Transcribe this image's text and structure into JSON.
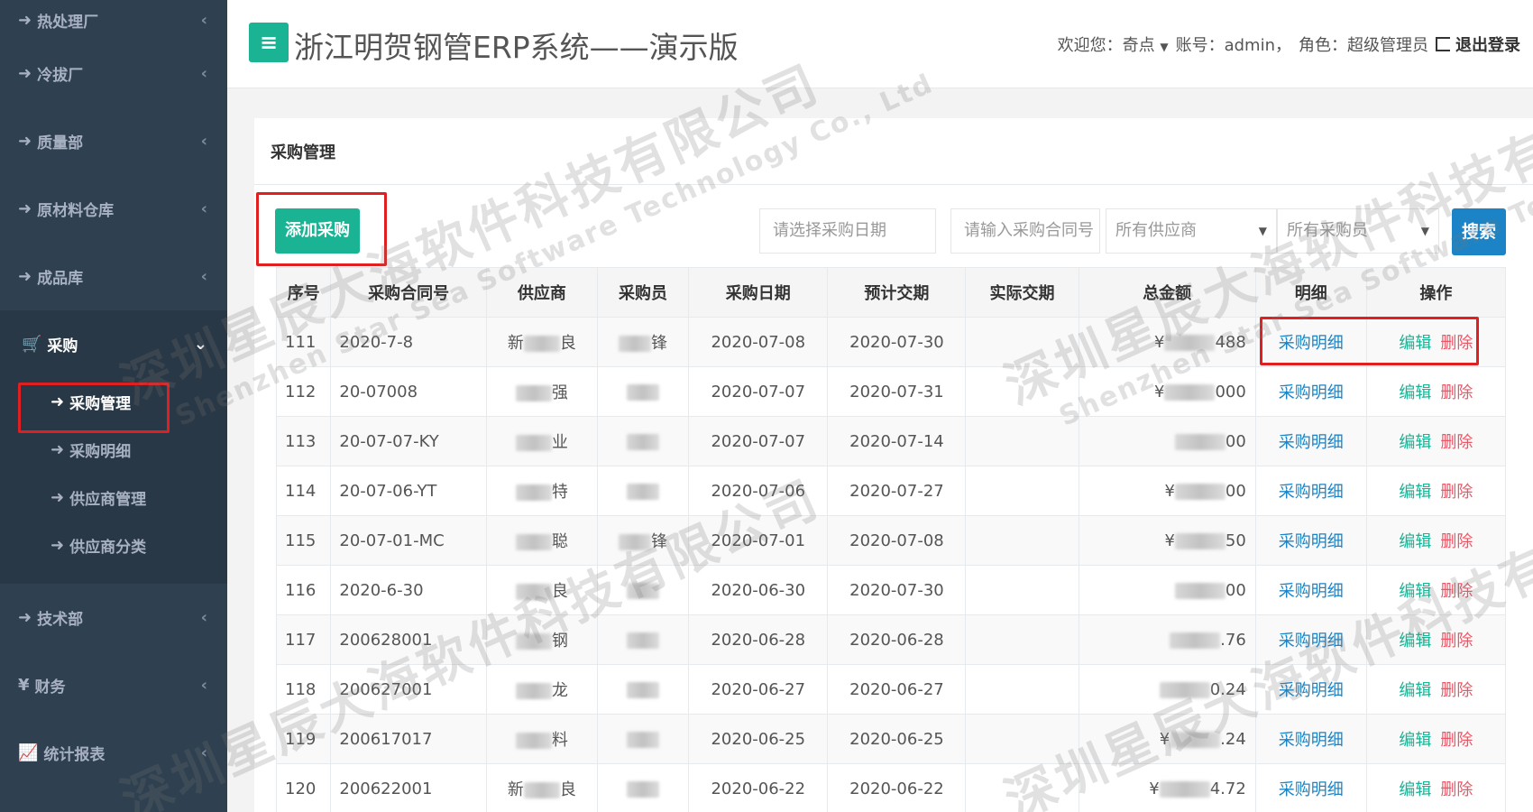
{
  "sidebar": {
    "items_top": [
      {
        "label": "热处理厂"
      },
      {
        "label": "冷拔厂"
      },
      {
        "label": "质量部"
      },
      {
        "label": "原材料仓库"
      },
      {
        "label": "成品库"
      }
    ],
    "active_group": {
      "label": "采购",
      "children": [
        {
          "label": "采购管理",
          "active": true
        },
        {
          "label": "采购明细"
        },
        {
          "label": "供应商管理"
        },
        {
          "label": "供应商分类"
        }
      ]
    },
    "items_bottom": [
      {
        "label": "技术部",
        "prefix": "➜"
      },
      {
        "label": "财务",
        "prefix": "¥"
      },
      {
        "label": "统计报表",
        "prefix": "📈"
      }
    ]
  },
  "header": {
    "title": "浙江明贺钢管ERP系统——演示版",
    "welcome": "欢迎您：奇点",
    "account": "账号：admin，",
    "role": "角色：超级管理员",
    "logout": "退出登录"
  },
  "panel": {
    "title": "采购管理",
    "add_button": "添加采购",
    "search": {
      "date_placeholder": "请选择采购日期",
      "contract_placeholder": "请输入采购合同号",
      "supplier_select": "所有供应商",
      "buyer_select": "所有采购员",
      "button": "搜索"
    },
    "table": {
      "headers": [
        "序号",
        "采购合同号",
        "供应商",
        "采购员",
        "采购日期",
        "预计交期",
        "实际交期",
        "总金额",
        "明细",
        "操作"
      ],
      "rows": [
        {
          "id": "111",
          "contract": "2020-7-8",
          "supplier_a": "新",
          "supplier_b": "良",
          "buyer": "锋",
          "date": "2020-07-08",
          "eta": "2020-07-30",
          "actual": "",
          "amount_a": "¥",
          "amount_b": "488"
        },
        {
          "id": "112",
          "contract": "20-07008",
          "supplier_a": "",
          "supplier_b": "强",
          "buyer": "",
          "date": "2020-07-07",
          "eta": "2020-07-31",
          "actual": "",
          "amount_a": "¥",
          "amount_b": "000"
        },
        {
          "id": "113",
          "contract": "20-07-07-KY",
          "supplier_a": "",
          "supplier_b": "业",
          "buyer": "",
          "date": "2020-07-07",
          "eta": "2020-07-14",
          "actual": "",
          "amount_a": "",
          "amount_b": "00"
        },
        {
          "id": "114",
          "contract": "20-07-06-YT",
          "supplier_a": "",
          "supplier_b": "特",
          "buyer": "",
          "date": "2020-07-06",
          "eta": "2020-07-27",
          "actual": "",
          "amount_a": "¥",
          "amount_b": "00"
        },
        {
          "id": "115",
          "contract": "20-07-01-MC",
          "supplier_a": "",
          "supplier_b": "聪",
          "buyer": "锋",
          "date": "2020-07-01",
          "eta": "2020-07-08",
          "actual": "",
          "amount_a": "¥",
          "amount_b": "50"
        },
        {
          "id": "116",
          "contract": "2020-6-30",
          "supplier_a": "",
          "supplier_b": "良",
          "buyer": "",
          "date": "2020-06-30",
          "eta": "2020-07-30",
          "actual": "",
          "amount_a": "",
          "amount_b": "00"
        },
        {
          "id": "117",
          "contract": "200628001",
          "supplier_a": "",
          "supplier_b": "钢",
          "buyer": "",
          "date": "2020-06-28",
          "eta": "2020-06-28",
          "actual": "",
          "amount_a": "",
          "amount_b": ".76"
        },
        {
          "id": "118",
          "contract": "200627001",
          "supplier_a": "",
          "supplier_b": "龙",
          "buyer": "",
          "date": "2020-06-27",
          "eta": "2020-06-27",
          "actual": "",
          "amount_a": "",
          "amount_b": "0.24"
        },
        {
          "id": "119",
          "contract": "200617017",
          "supplier_a": "",
          "supplier_b": "料",
          "buyer": "",
          "date": "2020-06-25",
          "eta": "2020-06-25",
          "actual": "",
          "amount_a": "¥",
          "amount_b": ".24"
        },
        {
          "id": "120",
          "contract": "200622001",
          "supplier_a": "新",
          "supplier_b": "良",
          "buyer": "",
          "date": "2020-06-22",
          "eta": "2020-06-22",
          "actual": "",
          "amount_a": "¥",
          "amount_b": "4.72"
        }
      ],
      "detail_link": "采购明细",
      "edit_link": "编辑",
      "delete_link": "删除"
    }
  },
  "watermark": {
    "cn": "深圳星辰大海软件科技有限公司",
    "en": "Shenzhen Star Sea Software Technology Co., Ltd"
  },
  "colors": {
    "sidebar": "#2f4050",
    "primary": "#1ab394",
    "blue": "#1c84c6",
    "danger": "#ed5565",
    "highlight": "#e02020"
  }
}
